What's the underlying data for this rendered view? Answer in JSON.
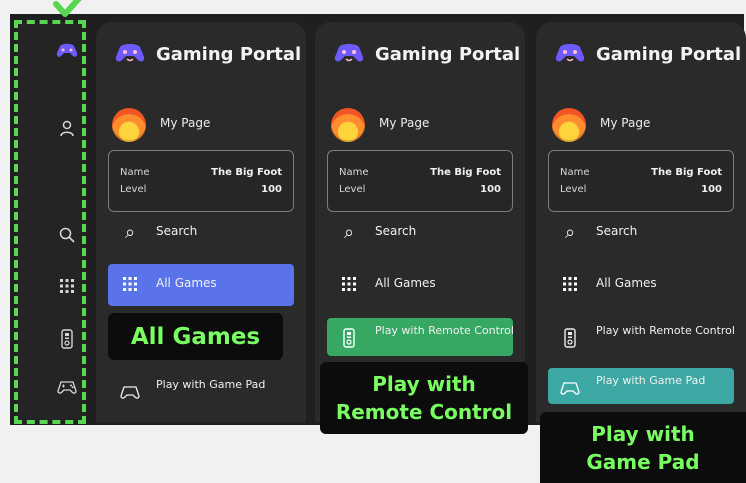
{
  "colors": {
    "background": "#f1f1f1",
    "dark_band": "#1f1f1f",
    "panel": "#2a2a2a",
    "blue_selected": "#5a73e9",
    "green_selected": "#37a864",
    "teal_selected": "#3da8a3",
    "callout_text": "#79ff62",
    "outline": "#58d64f"
  },
  "rail": {
    "icons": [
      "game-controller-icon",
      "user-icon",
      "search-icon",
      "grid-icon",
      "remote-control-icon",
      "gamepad-icon"
    ]
  },
  "panels": [
    {
      "title": "Gaming Portal",
      "my_page": "My Page",
      "profile": {
        "name_label": "Name",
        "name_value": "The Big Foot",
        "level_label": "Level",
        "level_value": "100"
      },
      "nav": [
        "Search",
        "All Games",
        "Play with Game Pad"
      ],
      "selected": "All Games"
    },
    {
      "title": "Gaming Portal",
      "my_page": "My Page",
      "profile": {
        "name_label": "Name",
        "name_value": "The Big Foot",
        "level_label": "Level",
        "level_value": "100"
      },
      "nav": [
        "Search",
        "All Games",
        "Play with Remote Control"
      ],
      "selected": "Play with Remote Control"
    },
    {
      "title": "Gaming Portal",
      "my_page": "My Page",
      "profile": {
        "name_label": "Name",
        "name_value": "The Big Foot",
        "level_label": "Level",
        "level_value": "100"
      },
      "nav": [
        "Search",
        "All Games",
        "Play with Remote Control",
        "Play with Game Pad"
      ],
      "selected": "Play with Game Pad"
    }
  ],
  "callouts": {
    "all_games": "All Games",
    "remote_control_line1": "Play with",
    "remote_control_line2": "Remote Control",
    "game_pad_line1": "Play with",
    "game_pad_line2": "Game Pad"
  }
}
